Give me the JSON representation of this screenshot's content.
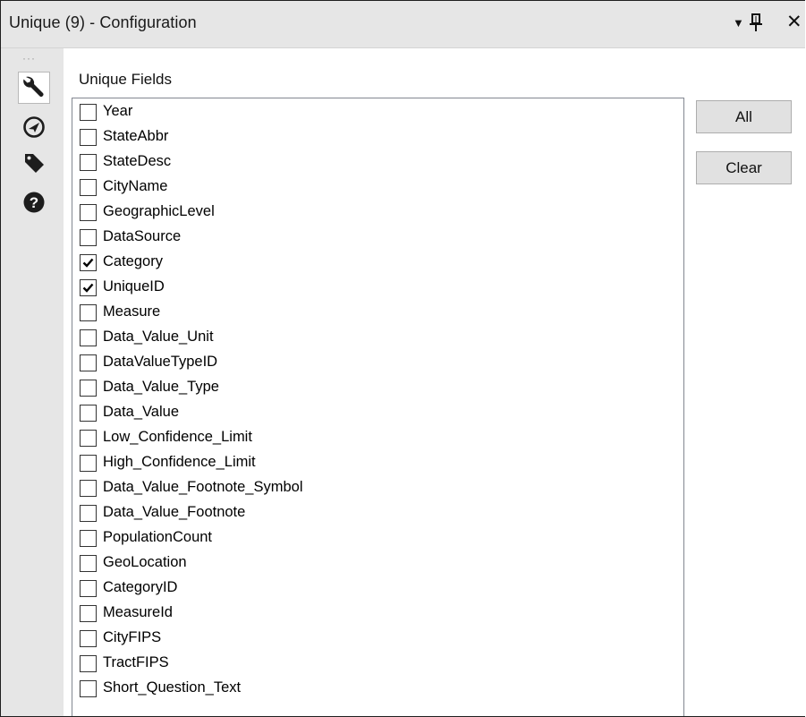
{
  "window": {
    "title": "Unique (9) - Configuration",
    "controls": {
      "dropdown_icon": "▼",
      "pin_icon": "pin-icon",
      "close_icon": "✕"
    }
  },
  "toolstrip": {
    "items": [
      {
        "name": "configuration",
        "icon": "wrench-icon",
        "active": true
      },
      {
        "name": "navigation",
        "icon": "compass-icon",
        "active": false
      },
      {
        "name": "annotation",
        "icon": "tag-icon",
        "active": false
      },
      {
        "name": "help",
        "icon": "help-icon",
        "active": false
      }
    ]
  },
  "unique_fields": {
    "label": "Unique Fields",
    "fields": [
      {
        "label": "Year",
        "checked": false
      },
      {
        "label": "StateAbbr",
        "checked": false
      },
      {
        "label": "StateDesc",
        "checked": false
      },
      {
        "label": "CityName",
        "checked": false
      },
      {
        "label": "GeographicLevel",
        "checked": false
      },
      {
        "label": "DataSource",
        "checked": false
      },
      {
        "label": "Category",
        "checked": true
      },
      {
        "label": "UniqueID",
        "checked": true
      },
      {
        "label": "Measure",
        "checked": false
      },
      {
        "label": "Data_Value_Unit",
        "checked": false
      },
      {
        "label": "DataValueTypeID",
        "checked": false
      },
      {
        "label": "Data_Value_Type",
        "checked": false
      },
      {
        "label": "Data_Value",
        "checked": false
      },
      {
        "label": "Low_Confidence_Limit",
        "checked": false
      },
      {
        "label": "High_Confidence_Limit",
        "checked": false
      },
      {
        "label": "Data_Value_Footnote_Symbol",
        "checked": false
      },
      {
        "label": "Data_Value_Footnote",
        "checked": false
      },
      {
        "label": "PopulationCount",
        "checked": false
      },
      {
        "label": "GeoLocation",
        "checked": false
      },
      {
        "label": "CategoryID",
        "checked": false
      },
      {
        "label": "MeasureId",
        "checked": false
      },
      {
        "label": "CityFIPS",
        "checked": false
      },
      {
        "label": "TractFIPS",
        "checked": false
      },
      {
        "label": "Short_Question_Text",
        "checked": false
      }
    ]
  },
  "buttons": {
    "all_label": "All",
    "clear_label": "Clear"
  }
}
